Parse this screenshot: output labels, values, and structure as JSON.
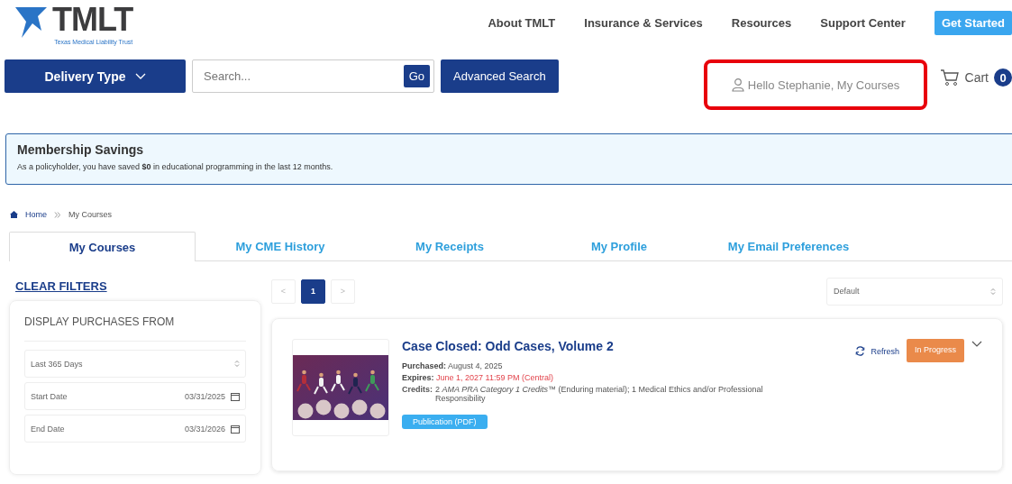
{
  "logo": {
    "wordmark": "TMLT",
    "tagline": "Texas Medical Liability Trust"
  },
  "nav": [
    {
      "label": "About TMLT"
    },
    {
      "label": "Insurance & Services"
    },
    {
      "label": "Resources"
    },
    {
      "label": "Support Center"
    }
  ],
  "cta_button": "Get Started",
  "toolbar": {
    "delivery_button": "Delivery Type",
    "search": {
      "placeholder": "Search...",
      "button": "Go"
    },
    "advanced_button": "Advanced Search",
    "greeting": {
      "label": "Hello Stephanie, My Courses",
      "highlighted": true
    },
    "cart": {
      "label": "Cart",
      "count": "0"
    }
  },
  "banner": {
    "title": "Membership Savings",
    "text": "As a policyholder, you have saved **$0** in educational programming in the last 12 months."
  },
  "breadcrumb": [
    {
      "label": "Home"
    },
    {
      "label": "My Courses"
    }
  ],
  "tabs": [
    {
      "label": "My Courses",
      "selected": true
    },
    {
      "label": "My CME History",
      "selected": false
    },
    {
      "label": "My Receipts",
      "selected": false
    },
    {
      "label": "My Profile",
      "selected": false
    },
    {
      "label": "My Email Preferences",
      "selected": false
    }
  ],
  "filters": {
    "clear_link": "CLEAR FILTERS",
    "title": "DISPLAY PURCHASES FROM",
    "range_select": "Last 365 Days",
    "start": {
      "label": "Start Date",
      "value": "03/31/2025"
    },
    "end": {
      "label": "End Date",
      "value": "03/31/2026"
    }
  },
  "pagination": {
    "prev": "<",
    "pages": [
      {
        "label": "1",
        "selected": true
      }
    ],
    "next": ">"
  },
  "sort_select": "Default",
  "courses": [
    {
      "title": "Case Closed: Odd Cases, Volume 2",
      "purchased_label": "Purchased:",
      "purchased": "August 4, 2025",
      "expires_label": "Expires:",
      "expires": "June 1, 2027 11:59 PM (Central)",
      "credits_label": "Credits:",
      "credits": "2 *AMA PRA Category 1 Credits*™ (Enduring material); 1 Medical Ethics and/or Professional Responsibility",
      "format": "Publication (PDF)",
      "refresh": "Refresh",
      "status": "In Progress"
    }
  ]
}
